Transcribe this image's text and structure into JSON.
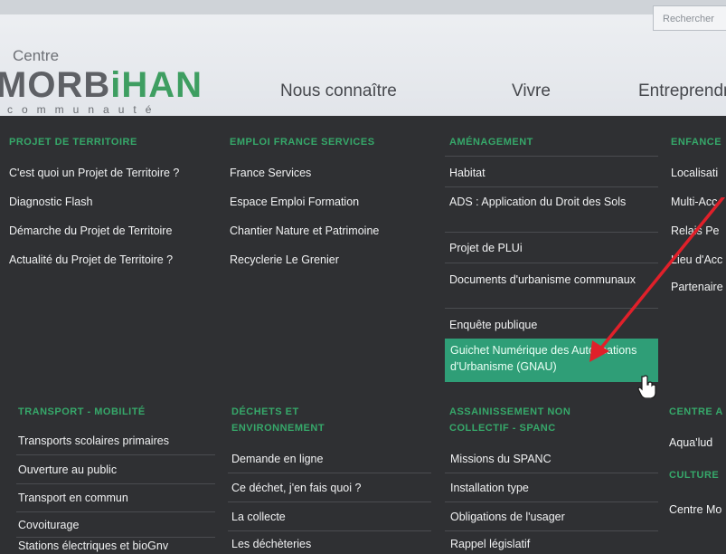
{
  "header": {
    "search_placeholder": "Rechercher",
    "logo": {
      "small": "Centre",
      "big_part1": "MORB",
      "big_part2": "iHAN",
      "sub": "communauté"
    },
    "nav": [
      "Nous connaître",
      "Vivre",
      "Entreprendre"
    ]
  },
  "menu": {
    "col1": {
      "title": "PROJET DE TERRITOIRE",
      "items": [
        "C'est quoi un Projet de Territoire ?",
        "Diagnostic Flash",
        "Démarche du Projet de Territoire",
        "Actualité du Projet de Territoire ?"
      ]
    },
    "col2": {
      "title": "EMPLOI FRANCE SERVICES",
      "items": [
        "France Services",
        "Espace Emploi Formation",
        "Chantier Nature et Patrimoine",
        "Recyclerie Le Grenier"
      ]
    },
    "col3": {
      "title": "AMÉNAGEMENT",
      "items": [
        "Habitat",
        "ADS : Application du Droit des Sols",
        "Projet de PLUi",
        "Documents d'urbanisme communaux",
        "Enquête publique",
        "Guichet Numérique des Autorisations d'Urbanisme (GNAU)"
      ]
    },
    "col4": {
      "title": "ENFANCE",
      "items": [
        "Localisati",
        "Multi-Acc",
        "Relais Pe",
        "Lieu d'Acc",
        "Partenaire"
      ]
    },
    "col5": {
      "title": "TRANSPORT - MOBILITÉ",
      "items": [
        "Transports scolaires primaires",
        "Ouverture au public",
        "Transport en commun",
        "Covoiturage",
        "Stations électriques et bioGnv"
      ]
    },
    "col6": {
      "title": "DÉCHETS ET ENVIRONNEMENT",
      "items": [
        "Demande en ligne",
        "Ce déchet, j'en fais quoi ?",
        "La collecte",
        "Les déchèteries"
      ]
    },
    "col7": {
      "title": "ASSAINISSEMENT NON COLLECTIF - SPANC",
      "items": [
        "Missions du SPANC",
        "Installation type",
        "Obligations de l'usager",
        "Rappel législatif"
      ]
    },
    "col8": {
      "title": "CENTRE A",
      "items": [
        "Aqua'lud"
      ]
    },
    "col9": {
      "title": "CULTURE",
      "items": [
        "Centre Mo"
      ]
    }
  },
  "colors": {
    "accent": "#36a86a",
    "highlight": "#2f9e77",
    "panel": "#2f3033",
    "arrow": "#e0202a"
  }
}
